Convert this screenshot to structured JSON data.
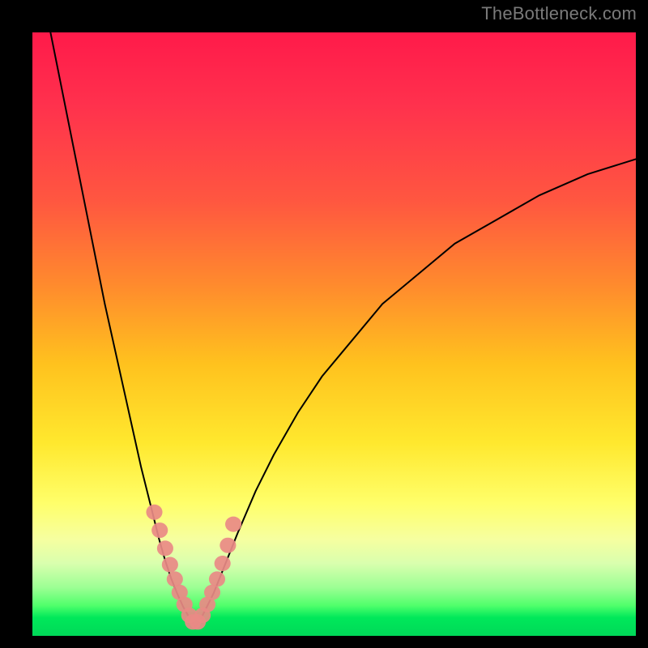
{
  "watermark": "TheBottleneck.com",
  "chart_data": {
    "type": "line",
    "title": "",
    "xlabel": "",
    "ylabel": "",
    "xlim": [
      0,
      100
    ],
    "ylim": [
      0,
      100
    ],
    "grid": false,
    "series": [
      {
        "name": "bottleneck-curve-left",
        "x": [
          3,
          4,
          6,
          8,
          10,
          12,
          14,
          16,
          18,
          20,
          21,
          22,
          23,
          24,
          25,
          26,
          27
        ],
        "y": [
          100,
          95,
          85,
          75,
          65,
          55,
          46,
          37,
          28,
          20,
          16,
          12.5,
          9.5,
          7,
          4.8,
          3,
          1.5
        ]
      },
      {
        "name": "bottleneck-curve-right",
        "x": [
          27,
          28,
          29,
          30,
          32,
          34,
          37,
          40,
          44,
          48,
          53,
          58,
          64,
          70,
          77,
          84,
          92,
          100
        ],
        "y": [
          1.5,
          3,
          5,
          7,
          12,
          17,
          24,
          30,
          37,
          43,
          49,
          55,
          60,
          65,
          69,
          73,
          76.5,
          79
        ]
      },
      {
        "name": "bead-markers",
        "x": [
          20.2,
          21.1,
          22.0,
          22.8,
          23.6,
          24.4,
          25.2,
          26.0,
          26.6,
          27.4,
          28.2,
          29.0,
          29.8,
          30.6,
          31.5,
          32.4,
          33.3
        ],
        "y": [
          20.5,
          17.5,
          14.5,
          11.8,
          9.4,
          7.2,
          5.2,
          3.4,
          2.3,
          2.3,
          3.4,
          5.2,
          7.2,
          9.4,
          12.0,
          15.0,
          18.5
        ]
      }
    ],
    "colors": {
      "curve": "#000000",
      "bead": "#e98a86"
    },
    "background_gradient": {
      "stops": [
        {
          "pos": 0.0,
          "color": "#ff1a4a"
        },
        {
          "pos": 0.28,
          "color": "#ff5740"
        },
        {
          "pos": 0.55,
          "color": "#ffc21e"
        },
        {
          "pos": 0.78,
          "color": "#ffff6a"
        },
        {
          "pos": 0.92,
          "color": "#9cff94"
        },
        {
          "pos": 1.0,
          "color": "#00d858"
        }
      ]
    }
  }
}
